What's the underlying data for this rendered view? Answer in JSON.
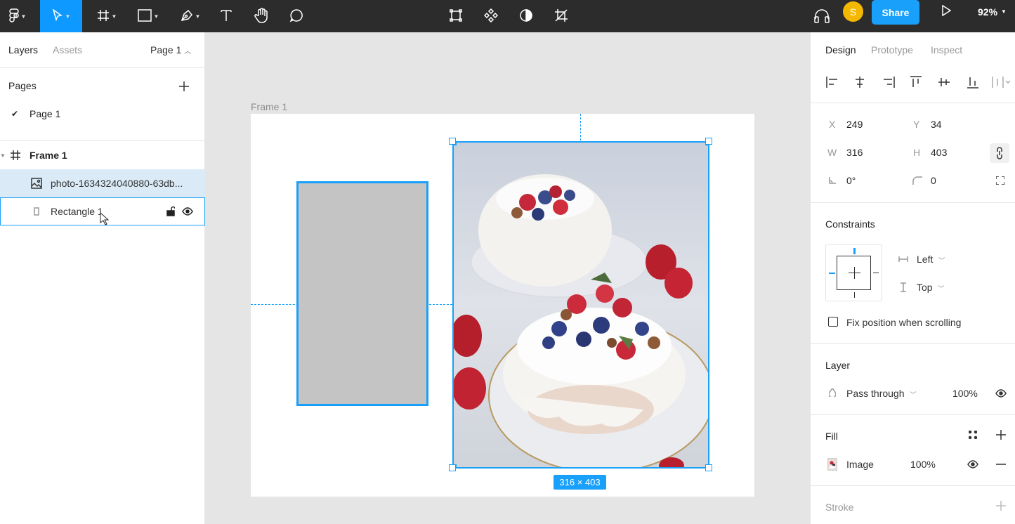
{
  "toolbar": {
    "tools": [
      {
        "name": "main-menu",
        "icon": "figma-logo-icon"
      },
      {
        "name": "move",
        "icon": "cursor-icon",
        "active": true
      },
      {
        "name": "frame",
        "icon": "frame-grid-icon"
      },
      {
        "name": "shape",
        "icon": "rectangle-icon"
      },
      {
        "name": "pen",
        "icon": "pen-icon"
      },
      {
        "name": "text",
        "icon": "text-icon"
      },
      {
        "name": "hand",
        "icon": "hand-icon"
      },
      {
        "name": "comment",
        "icon": "comment-icon"
      }
    ],
    "center_tools": [
      "component-icon",
      "component-set-icon",
      "contrast-icon",
      "crop-icon"
    ],
    "avatar_initial": "S",
    "share_label": "Share",
    "zoom_label": "92%",
    "accent_color": "#0d99ff"
  },
  "left_panel": {
    "tabs": {
      "layers": "Layers",
      "assets": "Assets",
      "page_selector": "Page 1"
    },
    "pages": {
      "title": "Pages",
      "items": [
        {
          "label": "Page 1",
          "checked": true
        }
      ]
    },
    "layers": [
      {
        "label": "Frame 1",
        "type": "frame"
      },
      {
        "label": "photo-1634324040880-63db...",
        "type": "image"
      },
      {
        "label": "Rectangle 1",
        "type": "rectangle"
      }
    ]
  },
  "canvas": {
    "frame_label": "Frame 1",
    "size_badge": "316 × 403",
    "selection_color": "#18a0fb"
  },
  "right_panel": {
    "tabs": {
      "design": "Design",
      "prototype": "Prototype",
      "inspect": "Inspect"
    },
    "transform": {
      "x_label": "X",
      "x": "249",
      "y_label": "Y",
      "y": "34",
      "w_label": "W",
      "w": "316",
      "h_label": "H",
      "h": "403",
      "rotation": "0°",
      "radius": "0"
    },
    "constraints": {
      "title": "Constraints",
      "horizontal": "Left",
      "vertical": "Top",
      "fix_position_label": "Fix position when scrolling"
    },
    "layer": {
      "title": "Layer",
      "blend": "Pass through",
      "opacity": "100%"
    },
    "fill": {
      "title": "Fill",
      "type": "Image",
      "opacity": "100%"
    },
    "stroke": {
      "title": "Stroke"
    }
  }
}
